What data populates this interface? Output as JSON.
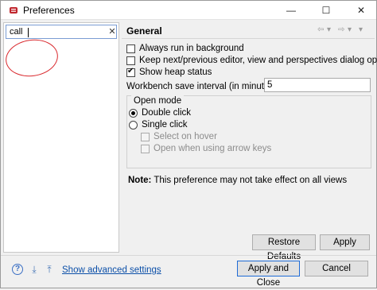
{
  "window": {
    "title": "Preferences",
    "min_glyph": "—",
    "max_glyph": "☐",
    "close_glyph": "✕"
  },
  "filter": {
    "value": "call",
    "clear_glyph": "✕"
  },
  "page": {
    "title": "General",
    "nav": {
      "back": "⇦",
      "back_menu": "▾",
      "forward": "⇨",
      "forward_menu": "▾",
      "view_menu": "▾"
    }
  },
  "options": [
    {
      "label": "Always run in background",
      "checked": false
    },
    {
      "label": "Keep next/previous editor, view and perspectives dialog open",
      "checked": false
    },
    {
      "label": "Show heap status",
      "checked": true
    }
  ],
  "interval": {
    "label": "Workbench save interval (in minutes):",
    "value": "5"
  },
  "open_mode": {
    "title": "Open mode",
    "double_click": "Double click",
    "single_click": "Single click",
    "select_on_hover": "Select on hover",
    "open_arrow_keys": "Open when using arrow keys"
  },
  "note": {
    "label": "Note:",
    "text": " This preference may not take effect on all views"
  },
  "buttons": {
    "restore": "Restore Defaults",
    "apply": "Apply",
    "apply_close": "Apply and Close",
    "cancel": "Cancel"
  },
  "footer": {
    "advanced_link": "Show advanced settings",
    "help_glyph": "?",
    "import_glyph": "⤓",
    "export_glyph": "⤒"
  },
  "colors": {
    "accent": "#1f6bd6",
    "annotation": "#d9272c",
    "link": "#0b4fa8"
  }
}
